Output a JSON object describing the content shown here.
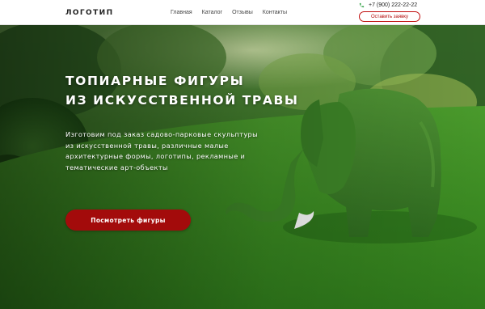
{
  "header": {
    "logo": "ЛОГОТИП",
    "nav": [
      "Главная",
      "Каталог",
      "Отзывы",
      "Контакты"
    ],
    "phone": "+7 (900) 222-22-22",
    "callback_label": "Оставить заявку"
  },
  "hero": {
    "title_lines": [
      "ТОПИАРНЫЕ ФИГУРЫ",
      "ИЗ ИСКУССТВЕННОЙ ТРАВЫ"
    ],
    "description_lines": [
      "Изготовим под заказ садово-парковые скульптуры",
      "из искусственной травы, различные малые",
      "архитектурные формы, логотипы, рекламные и",
      "тематические арт-объекты"
    ],
    "cta_label": "Посмотреть фигуры"
  },
  "icons": {
    "phone": "phone-icon"
  },
  "colors": {
    "accent": "#a30b0b",
    "callback_border": "#c00d0d",
    "phone_icon": "#2ea043"
  }
}
